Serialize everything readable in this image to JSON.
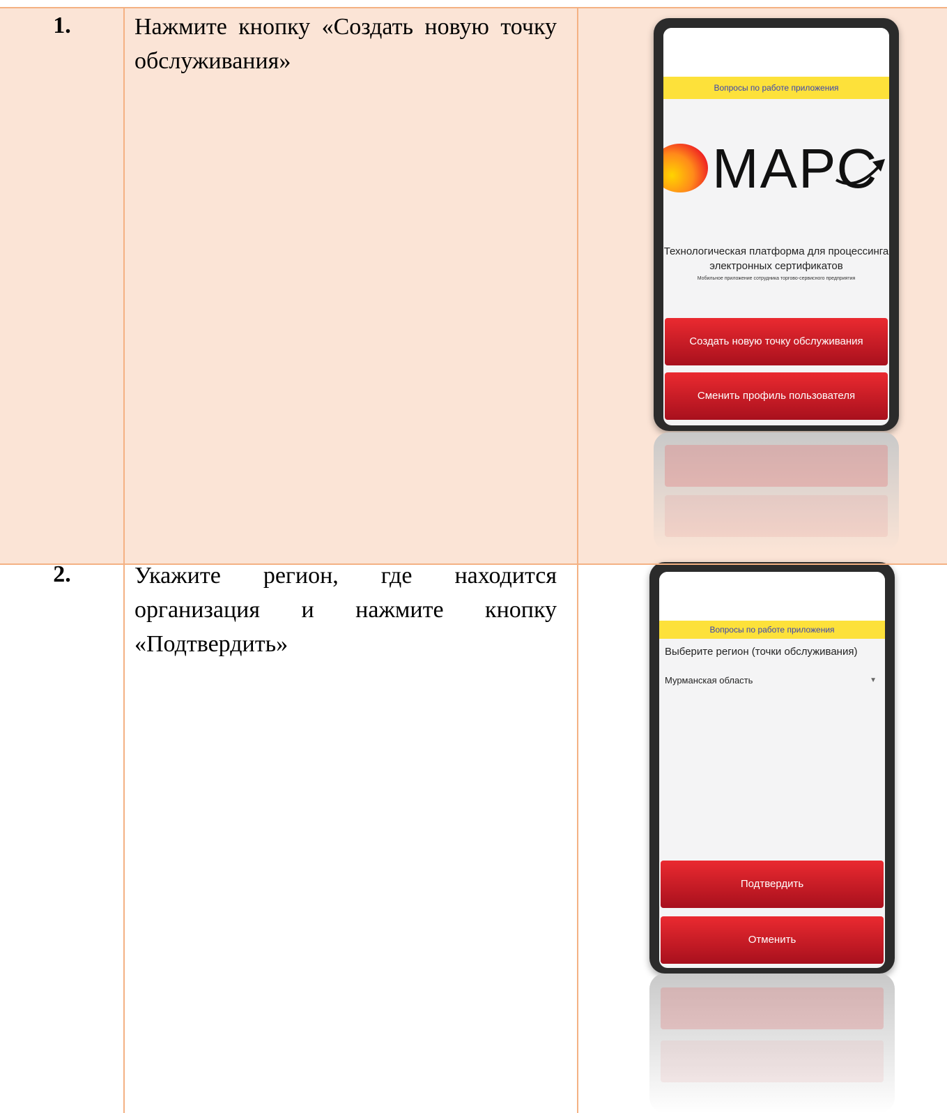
{
  "steps": [
    {
      "number": "1.",
      "instruction": "Нажмите кнопку «Создать новую точку обслуживания»",
      "phone": {
        "help_bar": "Вопросы по работе приложения",
        "logo_text": "МАРС",
        "tagline_line1": "Технологическая платформа для процессинга",
        "tagline_line2": "электронных сертификатов",
        "note": "Мобильное приложение сотрудника торгово-сервисного предприятия",
        "primary_button": "Создать новую точку обслуживания",
        "secondary_button": "Сменить профиль пользователя"
      }
    },
    {
      "number": "2.",
      "instruction": "Укажите регион, где находится организация и нажмите кнопку «Подтвердить»",
      "phone": {
        "help_bar": "Вопросы по работе приложения",
        "region_label": "Выберите регион (точки обслуживания)",
        "region_value": "Мурманская область",
        "confirm_button": "Подтвердить",
        "cancel_button": "Отменить"
      }
    }
  ],
  "colors": {
    "row_highlight": "#fbe4d6",
    "border": "#f4b183",
    "help_bar": "#fde13a",
    "button_red": "#d3202a"
  }
}
